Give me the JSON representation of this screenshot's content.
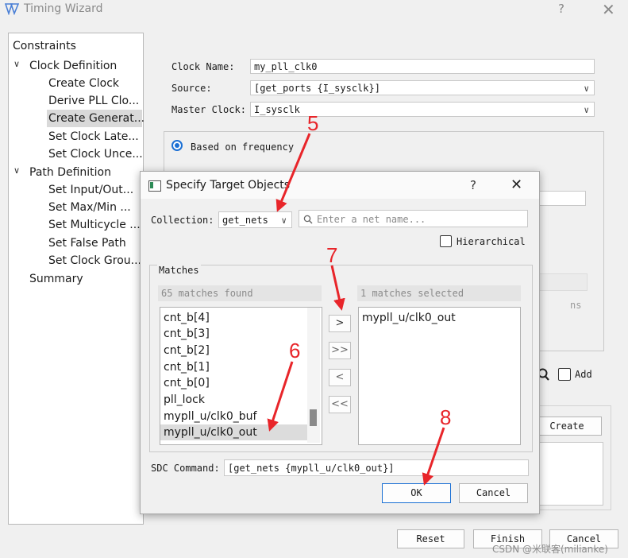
{
  "window": {
    "title": "Timing Wizard",
    "help": "?",
    "close": "✕"
  },
  "tree": {
    "root": "Constraints",
    "groups": [
      {
        "label": "Clock Definition",
        "items": [
          "Create Clock",
          "Derive PLL Clo...",
          "Create Generat...",
          "Set Clock Late...",
          "Set Clock Unce..."
        ]
      },
      {
        "label": "Path Definition",
        "items": [
          "Set Input/Out...",
          "Set Max/Min ...",
          "Set Multicycle ...",
          "Set False Path",
          "Set Clock Grou..."
        ]
      }
    ],
    "summary": "Summary",
    "selected": "Create Generat..."
  },
  "form": {
    "clock_name_label": "Clock Name:",
    "clock_name_value": "my_pll_clk0",
    "source_label": "Source:",
    "source_value": "[get_ports {I_sysclk}]",
    "master_clock_label": "Master Clock:",
    "master_clock_value": "I_sysclk",
    "radio_frequency": "Based on frequency",
    "ns_unit": "ns",
    "add_label": "Add",
    "create_button": "Create"
  },
  "footer": {
    "reset": "Reset",
    "finish": "Finish",
    "cancel": "Cancel",
    "watermark": "CSDN @米联客(milianke)"
  },
  "dialog": {
    "title": "Specify Target Objects",
    "help": "?",
    "close": "✕",
    "collection_label": "Collection:",
    "collection_value": "get_nets",
    "search_placeholder": "Enter a net name...",
    "hierarchical_label": "Hierarchical",
    "matches_label": "Matches",
    "matches_found": "65 matches found",
    "matches_selected": "1 matches selected",
    "left_items": [
      "cnt_b[4]",
      "cnt_b[3]",
      "cnt_b[2]",
      "cnt_b[1]",
      "cnt_b[0]",
      "pll_lock",
      "mypll_u/clk0_buf",
      "mypll_u/clk0_out"
    ],
    "right_items": [
      "mypll_u/clk0_out"
    ],
    "btn_add": ">",
    "btn_add_all": ">>",
    "btn_remove": "<",
    "btn_remove_all": "<<",
    "sdc_label": "SDC Command:",
    "sdc_value": "[get_nets {mypll_u/clk0_out}]",
    "ok": "OK",
    "cancel": "Cancel"
  },
  "annotations": [
    "5",
    "6",
    "7",
    "8"
  ],
  "colors": {
    "accent": "#1a6fd4",
    "annotation": "#e8252a",
    "selection": "#d9d9d9"
  }
}
